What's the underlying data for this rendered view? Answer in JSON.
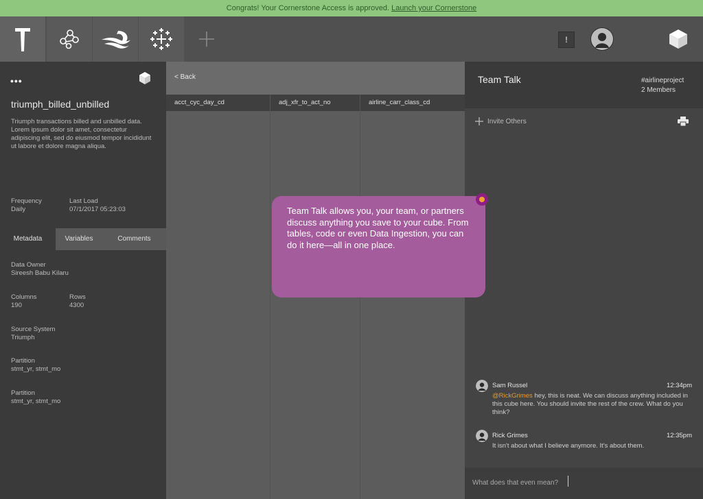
{
  "banner": {
    "text": "Congrats! Your Cornerstone Access is approved.",
    "link": "Launch your Cornerstone"
  },
  "topbar": {
    "icons": [
      "hammer-icon",
      "network-icon",
      "data-ingestion-icon",
      "tableau-icon",
      "plus-icon"
    ],
    "alert_label": "!",
    "right_icons": [
      "user-avatar-icon",
      "cube-icon"
    ]
  },
  "cube": {
    "more": "•••",
    "name": "triumph_billed_unbilled",
    "description": "Triumph transactions billed and unbilled data. Lorem ipsum dolor sit amet, consectetur adipiscing elit, sed do eiusmod tempor incididunt ut labore et dolore magna aliqua.",
    "frequency_label": "Frequency",
    "frequency_value": "Daily",
    "last_load_label": "Last Load",
    "last_load_value": "07/1/2017 05:23:03"
  },
  "tabs": [
    "Metadata",
    "Variables",
    "Comments"
  ],
  "metadata": {
    "data_owner_label": "Data Owner",
    "data_owner_value": "Sireesh Babu Kilaru",
    "columns_label": "Columns",
    "columns_value": "190",
    "rows_label": "Rows",
    "rows_value": "4300",
    "source_label": "Source System",
    "source_value": "Triumph",
    "partition1_label": "Partition",
    "partition1_value": "stmt_yr, stmt_mo",
    "partition2_label": "Partition",
    "partition2_value": "stmt_yr, stmt_mo"
  },
  "table": {
    "back": "< Back",
    "columns": [
      "acct_cyc_day_cd",
      "adj_xfr_to_act_no",
      "airline_carr_class_cd"
    ]
  },
  "tooltip": {
    "text": "Team Talk allows you, your team, or partners discuss anything you save to your cube. From tables, code or even Data Ingestion, you can do it here—all in one place."
  },
  "team": {
    "title": "Team Talk",
    "project": "#airlineproject",
    "members": "2 Members",
    "invite": "Invite Others",
    "messages": [
      {
        "name": "Sam Russel",
        "time": "12:34pm",
        "mention": "@RickGrimes",
        "text": " hey, this is neat. We can discuss anything included in this cube here. You should invite the rest of the crew. What do you think?"
      },
      {
        "name": "Rick Grimes",
        "time": "12:35pm",
        "mention": "",
        "text": "It isn't about what I believe anymore. It's about them."
      }
    ],
    "input_placeholder": "What does that even mean?"
  }
}
